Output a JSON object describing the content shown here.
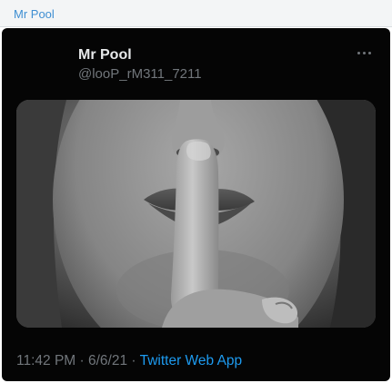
{
  "window": {
    "title": "Mr Pool"
  },
  "tweet": {
    "author_name": "Mr Pool",
    "author_handle": "@looP_rM311_7211",
    "more_icon": "more-horizontal-icon",
    "media": {
      "alt_subject": "black-and-white photo of a person holding a finger to their lips"
    },
    "time": "11:42 PM",
    "separator1": " · ",
    "date": "6/6/21",
    "separator2": " · ",
    "source": "Twitter Web App"
  },
  "colors": {
    "tab_title": "#3f8fd2",
    "tweet_background": "#050505",
    "name_text": "#e7e9ea",
    "secondary_text": "#71767b",
    "link": "#1d9bf0"
  }
}
